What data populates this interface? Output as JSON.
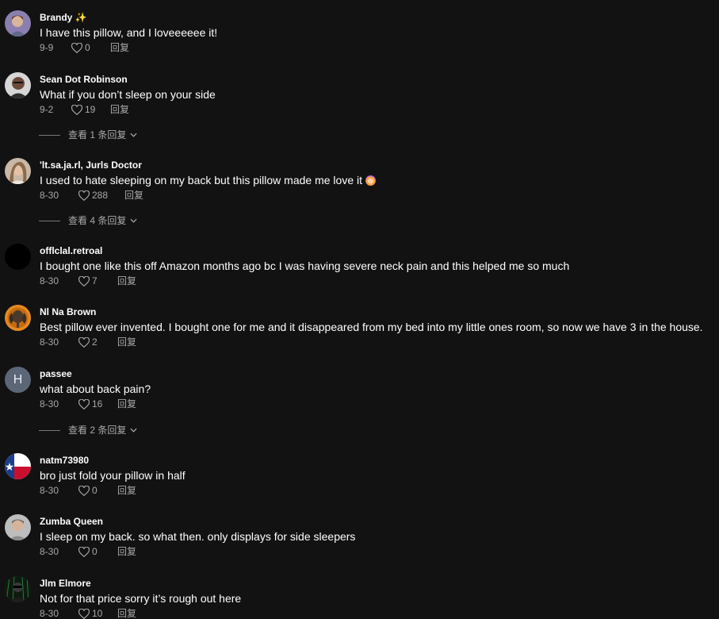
{
  "reply_label": "回复",
  "comments": [
    {
      "user": "Brandy ✨",
      "text": "I have this pillow, and I loveeeeee it!",
      "date": "9-9",
      "likes": "0",
      "avatar": "photo-purple"
    },
    {
      "user": "Sean Dot Robinson",
      "text": "What if you don’t sleep on your side",
      "date": "9-2",
      "likes": "19",
      "avatar": "photo-man",
      "view_replies": "查看 1 条回复"
    },
    {
      "user": "'lt.sa.ja.rl, Jurls Doctor",
      "text": "I used to hate sleeping on my back but this pillow made me love it",
      "date": "8-30",
      "likes": "288",
      "avatar": "photo-woman",
      "view_replies": "查看 4 条回复"
    },
    {
      "user": "offlclal.retroal",
      "text": "I bought one like this off Amazon months ago bc I was having severe neck pain and this helped me so much",
      "date": "8-30",
      "likes": "7",
      "avatar": "black"
    },
    {
      "user": "Nl Na Brown",
      "text": "Best pillow ever invented. I bought one for me and it disappeared from my bed into my little ones room, so now we have 3 in the house.",
      "date": "8-30",
      "likes": "2",
      "avatar": "elephant"
    },
    {
      "user": "passee",
      "text": "what about back pain?",
      "date": "8-30",
      "likes": "16",
      "avatar": "letter",
      "avatar_letter": "H",
      "view_replies": "查看 2 条回复"
    },
    {
      "user": "natm73980",
      "text": "bro just fold your pillow in half",
      "date": "8-30",
      "likes": "0",
      "avatar": "texas-flag"
    },
    {
      "user": "Zumba Queen",
      "text": "I sleep on my back. so what then. only displays for side sleepers",
      "date": "8-30",
      "likes": "0",
      "avatar": "photo-grey"
    },
    {
      "user": "Jlm Elmore",
      "text": "Not for that price sorry it’s rough out here",
      "date": "8-30",
      "likes": "10",
      "avatar": "photo-dark"
    }
  ],
  "colors": {
    "background": "#121212",
    "text": "#ffffff",
    "meta": "#a8a8a8"
  }
}
